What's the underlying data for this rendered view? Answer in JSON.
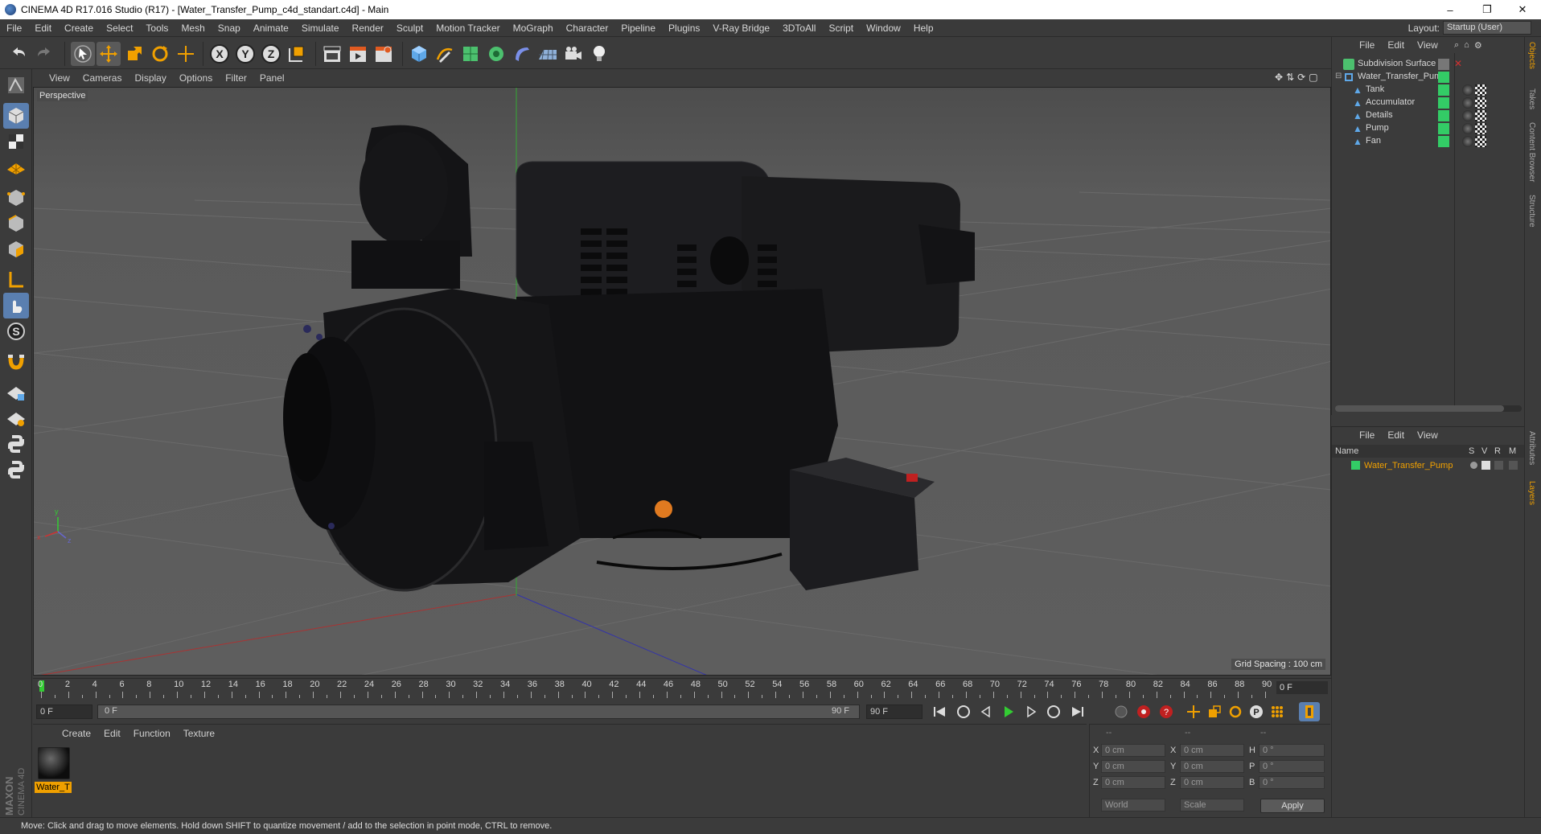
{
  "titlebar": {
    "title": "CINEMA 4D R17.016 Studio (R17) - [Water_Transfer_Pump_c4d_standart.c4d] - Main",
    "minimize": "–",
    "restore": "❐",
    "close": "✕"
  },
  "menubar": {
    "items": [
      "File",
      "Edit",
      "Create",
      "Select",
      "Tools",
      "Mesh",
      "Snap",
      "Animate",
      "Simulate",
      "Render",
      "Sculpt",
      "Motion Tracker",
      "MoGraph",
      "Character",
      "Pipeline",
      "Plugins",
      "V-Ray Bridge",
      "3DToAll",
      "Script",
      "Window",
      "Help"
    ],
    "layout_label": "Layout:",
    "layout_value": "Startup (User)"
  },
  "viewport": {
    "menu": [
      "View",
      "Cameras",
      "Display",
      "Options",
      "Filter",
      "Panel"
    ],
    "label": "Perspective",
    "grid_spacing": "Grid Spacing : 100 cm"
  },
  "timeline": {
    "ticks": [
      "0",
      "2",
      "4",
      "6",
      "8",
      "10",
      "12",
      "14",
      "16",
      "18",
      "20",
      "22",
      "24",
      "26",
      "28",
      "30",
      "32",
      "34",
      "36",
      "38",
      "40",
      "42",
      "44",
      "46",
      "48",
      "50",
      "52",
      "54",
      "56",
      "58",
      "60",
      "62",
      "64",
      "66",
      "68",
      "70",
      "72",
      "74",
      "76",
      "78",
      "80",
      "82",
      "84",
      "86",
      "88",
      "90"
    ],
    "current_frame": "0 F"
  },
  "transport": {
    "start_frame": "0 F",
    "range_start": "0 F",
    "range_end": "90 F",
    "end_frame": "90 F"
  },
  "material_manager": {
    "menu": [
      "Create",
      "Edit",
      "Function",
      "Texture"
    ],
    "material_name": "Water_T"
  },
  "coords": {
    "header": [
      "--",
      "--",
      "--"
    ],
    "rows": [
      {
        "axis": "X",
        "pos": "0 cm",
        "axis2": "X",
        "size": "0 cm",
        "rot_lbl": "H",
        "rot": "0 °"
      },
      {
        "axis": "Y",
        "pos": "0 cm",
        "axis2": "Y",
        "size": "0 cm",
        "rot_lbl": "P",
        "rot": "0 °"
      },
      {
        "axis": "Z",
        "pos": "0 cm",
        "axis2": "Z",
        "size": "0 cm",
        "rot_lbl": "B",
        "rot": "0 °"
      }
    ],
    "mode1": "World",
    "mode2": "Scale",
    "apply": "Apply"
  },
  "object_manager": {
    "menu": [
      "File",
      "Edit",
      "View"
    ],
    "objects": [
      {
        "name": "Subdivision Surface",
        "indent": 0,
        "color": "#6fcf6f"
      },
      {
        "name": "Water_Transfer_Pump",
        "indent": 0,
        "color": "#d8d8d8"
      },
      {
        "name": "Tank",
        "indent": 1,
        "color": "#d8d8d8"
      },
      {
        "name": "Accumulator",
        "indent": 1,
        "color": "#d8d8d8"
      },
      {
        "name": "Details",
        "indent": 1,
        "color": "#d8d8d8"
      },
      {
        "name": "Pump",
        "indent": 1,
        "color": "#d8d8d8"
      },
      {
        "name": "Fan",
        "indent": 1,
        "color": "#d8d8d8"
      }
    ]
  },
  "layer_manager": {
    "menu": [
      "File",
      "Edit",
      "View"
    ],
    "columns": [
      "Name",
      "S",
      "V",
      "R",
      "M"
    ],
    "layer_name": "Water_Transfer_Pump"
  },
  "right_tabs": [
    "Objects",
    "Takes",
    "Content Browser",
    "Structure"
  ],
  "right_tabs_lower": [
    "Attributes",
    "Layers"
  ],
  "statusbar": {
    "text": "Move: Click and drag to move elements. Hold down SHIFT to quantize movement / add to the selection in point mode, CTRL to remove."
  },
  "colors": {
    "accent": "#f0a000",
    "layer_green": "#33cc66"
  }
}
